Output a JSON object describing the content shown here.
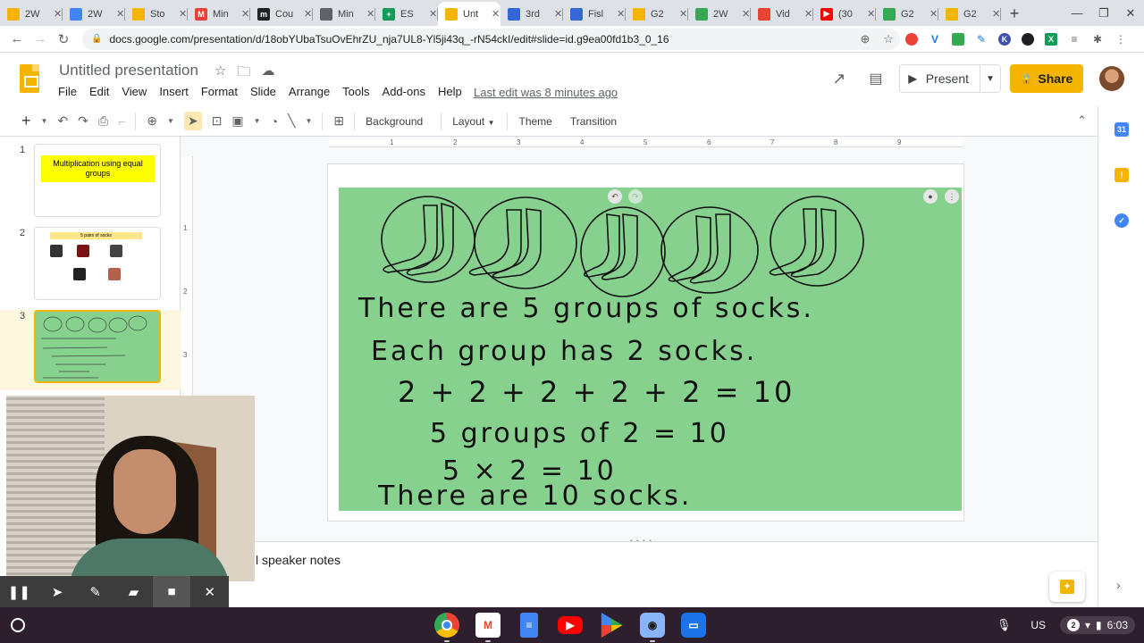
{
  "browser": {
    "tabs": [
      {
        "label": "2W",
        "icon": "slides-icon",
        "color": "#f4b400",
        "glyph": ""
      },
      {
        "label": "2W",
        "icon": "docs-icon",
        "color": "#4285f4",
        "glyph": ""
      },
      {
        "label": "Sto",
        "icon": "slides-icon",
        "color": "#f4b400",
        "glyph": ""
      },
      {
        "label": "Min",
        "icon": "gmail-icon",
        "color": "#ea4335",
        "glyph": "M"
      },
      {
        "label": "Cou",
        "icon": "circle-m-icon",
        "color": "#202124",
        "glyph": "m"
      },
      {
        "label": "Min",
        "icon": "globe-icon",
        "color": "#5f6368",
        "glyph": ""
      },
      {
        "label": "ES",
        "icon": "sheets-icon",
        "color": "#0f9d58",
        "glyph": "+"
      },
      {
        "label": "Unt",
        "icon": "slides-icon",
        "color": "#f4b400",
        "glyph": ""
      },
      {
        "label": "3rd",
        "icon": "arrow-icon",
        "color": "#3367d6",
        "glyph": ""
      },
      {
        "label": "Fisl",
        "icon": "arrow-icon",
        "color": "#3367d6",
        "glyph": ""
      },
      {
        "label": "G2",
        "icon": "slides-icon",
        "color": "#f4b400",
        "glyph": ""
      },
      {
        "label": "2W",
        "icon": "image-icon",
        "color": "#34a853",
        "glyph": ""
      },
      {
        "label": "Vid",
        "icon": "video-icon",
        "color": "#ea4335",
        "glyph": ""
      },
      {
        "label": "(30",
        "icon": "youtube-icon",
        "color": "#ff0000",
        "glyph": "▶"
      },
      {
        "label": "G2",
        "icon": "drive-icon",
        "color": "#34a853",
        "glyph": ""
      },
      {
        "label": "G2",
        "icon": "slides-icon",
        "color": "#f4b400",
        "glyph": ""
      }
    ],
    "active_tab": 7,
    "url": "docs.google.com/presentation/d/18obYUbaTsuOvEhrZU_nja7UL8-Yl5ji43q_-rN54ckI/edit#slide=id.g9ea00fd1b3_0_16"
  },
  "header": {
    "title": "Untitled presentation",
    "menus": [
      "File",
      "Edit",
      "View",
      "Insert",
      "Format",
      "Slide",
      "Arrange",
      "Tools",
      "Add-ons",
      "Help"
    ],
    "last_edit": "Last edit was 8 minutes ago",
    "present_label": "Present",
    "share_label": "Share"
  },
  "toolbar": {
    "background_label": "Background",
    "layout_label": "Layout",
    "theme_label": "Theme",
    "transition_label": "Transition"
  },
  "filmstrip": {
    "slides": [
      {
        "num": "1",
        "title": "Multiplication using equal groups"
      },
      {
        "num": "2",
        "title": "5 pairs of socks"
      },
      {
        "num": "3",
        "title": ""
      }
    ],
    "active": 3
  },
  "ruler": {
    "h_ticks": [
      "1",
      "2",
      "3",
      "4",
      "5",
      "6",
      "7",
      "8",
      "9"
    ],
    "v_ticks": [
      "1",
      "2",
      "3"
    ]
  },
  "slide": {
    "background_color": "#87d18f",
    "lines": [
      "There are 5 groups of socks.",
      "Each group has 2 socks.",
      "2 + 2 + 2 + 2 + 2 = 10",
      "5 groups of 2 = 10",
      "5 × 2 = 10",
      "There are 10 socks."
    ]
  },
  "notes": {
    "text": "l speaker notes"
  },
  "shelf": {
    "input_method": "US",
    "notification_count": "2",
    "time": "6:03"
  },
  "colors": {
    "accent": "#f4b400",
    "shelf_bg": "#2d1f2e",
    "slide_green": "#87d18f"
  }
}
